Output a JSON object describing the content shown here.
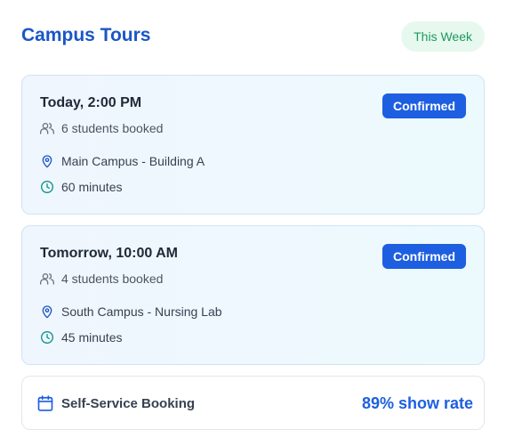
{
  "header": {
    "title": "Campus Tours",
    "period_label": "This Week"
  },
  "tours": [
    {
      "time": "Today, 2:00 PM",
      "status": "Confirmed",
      "students": "6 students booked",
      "location": "Main Campus - Building A",
      "duration": "60 minutes"
    },
    {
      "time": "Tomorrow, 10:00 AM",
      "status": "Confirmed",
      "students": "4 students booked",
      "location": "South Campus - Nursing Lab",
      "duration": "45 minutes"
    }
  ],
  "booking": {
    "label": "Self-Service Booking",
    "show_rate": "89% show rate"
  },
  "icons": {
    "students": "users-icon",
    "location": "map-pin-icon",
    "duration": "clock-icon",
    "booking": "calendar-icon"
  },
  "colors": {
    "title": "#1a56c8",
    "accent": "#1d5fe0",
    "pill_bg": "#e7f8ef",
    "pill_text": "#1c9a5c",
    "pin_icon": "#1a56c8",
    "clock_icon": "#0d9488"
  }
}
